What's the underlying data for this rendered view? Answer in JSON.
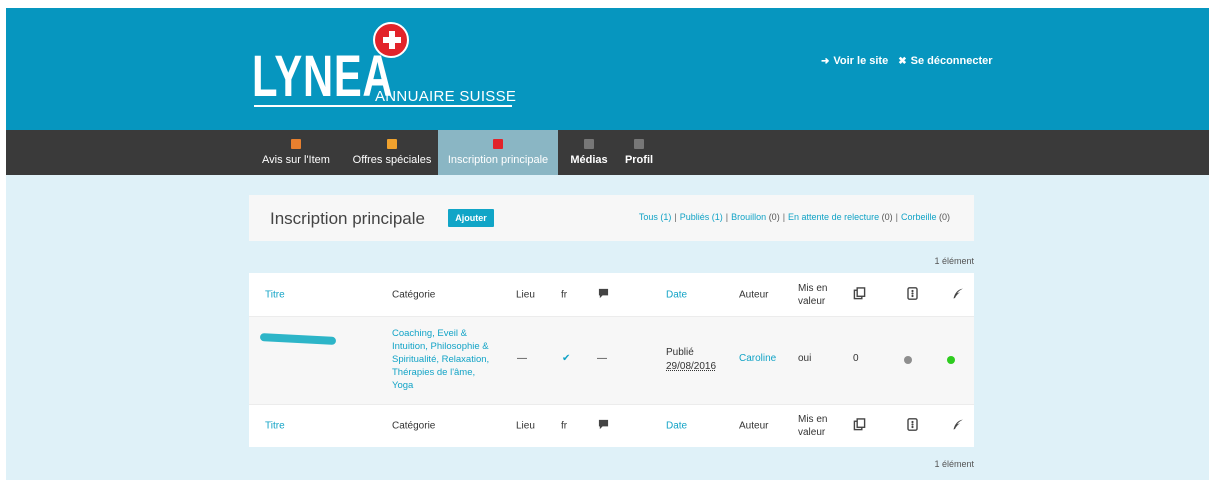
{
  "header": {
    "logo_text": "LYNEA",
    "logo_subtitle": "ANNUAIRE SUISSE",
    "links": [
      {
        "label": "Voir le site",
        "icon": "sign-in-icon"
      },
      {
        "label": "Se déconnecter",
        "icon": "close-icon"
      }
    ]
  },
  "nav": {
    "items": [
      {
        "label": "Avis sur l'Item",
        "icon": "star-icon",
        "color": "#e8802f"
      },
      {
        "label": "Offres spéciales",
        "icon": "gift-icon",
        "color": "#f0a22e"
      },
      {
        "label": "Inscription principale",
        "icon": "list-icon",
        "color": "#e2232a"
      },
      {
        "label": "Médias",
        "icon": "media-icon",
        "color": "#777777"
      },
      {
        "label": "Profil",
        "icon": "user-icon",
        "color": "#777777"
      }
    ]
  },
  "panel": {
    "title": "Inscription principale",
    "add_button": "Ajouter",
    "filters": [
      {
        "label": "Tous",
        "count": "(1)"
      },
      {
        "label": "Publiés",
        "count": "(1)"
      },
      {
        "label": "Brouillon",
        "count": "(0)"
      },
      {
        "label": "En attente de relecture",
        "count": "(0)"
      },
      {
        "label": "Corbeille",
        "count": "(0)"
      }
    ]
  },
  "count_top": "1 élément",
  "count_bottom": "1 élément",
  "table": {
    "columns": {
      "title": "Titre",
      "category": "Catégorie",
      "place": "Lieu",
      "lang": "fr",
      "date": "Date",
      "author": "Auteur",
      "featured_line1": "Mis en",
      "featured_line2": "valeur"
    },
    "row": {
      "category_lines": [
        "Coaching, Eveil &",
        "Intuition, Philosophie &",
        "Spiritualité, Relaxation,",
        "Thérapies de l'âme,",
        "Yoga"
      ],
      "place": "—",
      "lang_check": "✔",
      "comments": "—",
      "status": "Publié",
      "date": "29/08/2016",
      "author": "Caroline",
      "featured": "oui",
      "translations": "0"
    }
  },
  "colors": {
    "header_bg": "#0696bf",
    "nav_bg": "#3a3a3a",
    "accent": "#12a3c6",
    "status_grey": "#8e8e8e",
    "status_green": "#2ecc1f"
  }
}
